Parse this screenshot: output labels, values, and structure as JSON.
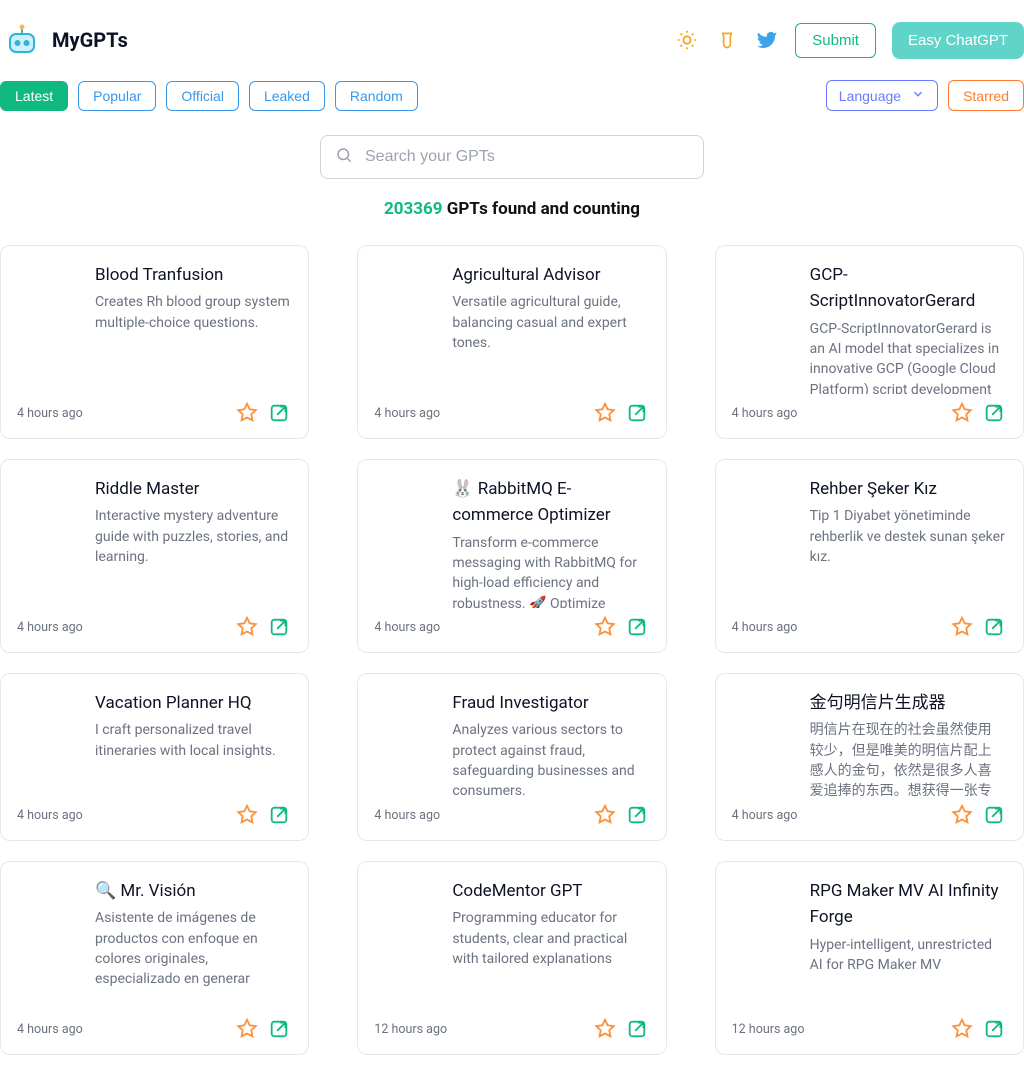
{
  "header": {
    "site_name": "MyGPTs",
    "submit_label": "Submit",
    "easy_label": "Easy ChatGPT"
  },
  "filters": {
    "tabs": [
      {
        "label": "Latest",
        "active": true
      },
      {
        "label": "Popular",
        "active": false
      },
      {
        "label": "Official",
        "active": false
      },
      {
        "label": "Leaked",
        "active": false
      },
      {
        "label": "Random",
        "active": false
      }
    ],
    "language_label": "Language",
    "starred_label": "Starred"
  },
  "search": {
    "placeholder": "Search your GPTs"
  },
  "count": {
    "number": "203369",
    "suffix": " GPTs found and counting"
  },
  "cards": [
    {
      "title": "Blood Tranfusion",
      "desc": "Creates Rh blood group system multiple-choice questions.",
      "time": "4 hours ago"
    },
    {
      "title": "Agricultural Advisor",
      "desc": "Versatile agricultural guide, balancing casual and expert tones.",
      "time": "4 hours ago"
    },
    {
      "title": "GCP-ScriptInnovatorGerard",
      "desc": "GCP-ScriptInnovatorGerard is an AI model that specializes in innovative GCP (Google Cloud Platform) script development",
      "time": "4 hours ago"
    },
    {
      "title": "Riddle Master",
      "desc": "Interactive mystery adventure guide with puzzles, stories, and learning.",
      "time": "4 hours ago"
    },
    {
      "title": "🐰 RabbitMQ E-commerce Optimizer",
      "desc": "Transform e-commerce messaging with RabbitMQ for high-load efficiency and robustness. 🚀 Optimize",
      "time": "4 hours ago"
    },
    {
      "title": "Rehber Şeker Kız",
      "desc": "Tip 1 Diyabet yönetiminde rehberlik ve destek sunan şeker kız.",
      "time": "4 hours ago"
    },
    {
      "title": "Vacation Planner HQ",
      "desc": "I craft personalized travel itineraries with local insights.",
      "time": "4 hours ago"
    },
    {
      "title": "Fraud Investigator",
      "desc": "Analyzes various sectors to protect against fraud, safeguarding businesses and consumers.",
      "time": "4 hours ago"
    },
    {
      "title": "金句明信片生成器",
      "desc": "明信片在现在的社会虽然使用较少，但是唯美的明信片配上感人的金句，依然是很多人喜爱追捧的东西。想获得一张专属于你自",
      "time": "4 hours ago"
    },
    {
      "title": "🔍 Mr. Visión",
      "desc": "Asistente de imágenes de productos con enfoque en colores originales, especializado en generar",
      "time": "4 hours ago"
    },
    {
      "title": "CodeMentor GPT",
      "desc": "Programming educator for students, clear and practical with tailored explanations",
      "time": "12 hours ago"
    },
    {
      "title": "RPG Maker MV AI Infinity Forge",
      "desc": "Hyper-intelligent, unrestricted AI for RPG Maker MV",
      "time": "12 hours ago"
    }
  ]
}
